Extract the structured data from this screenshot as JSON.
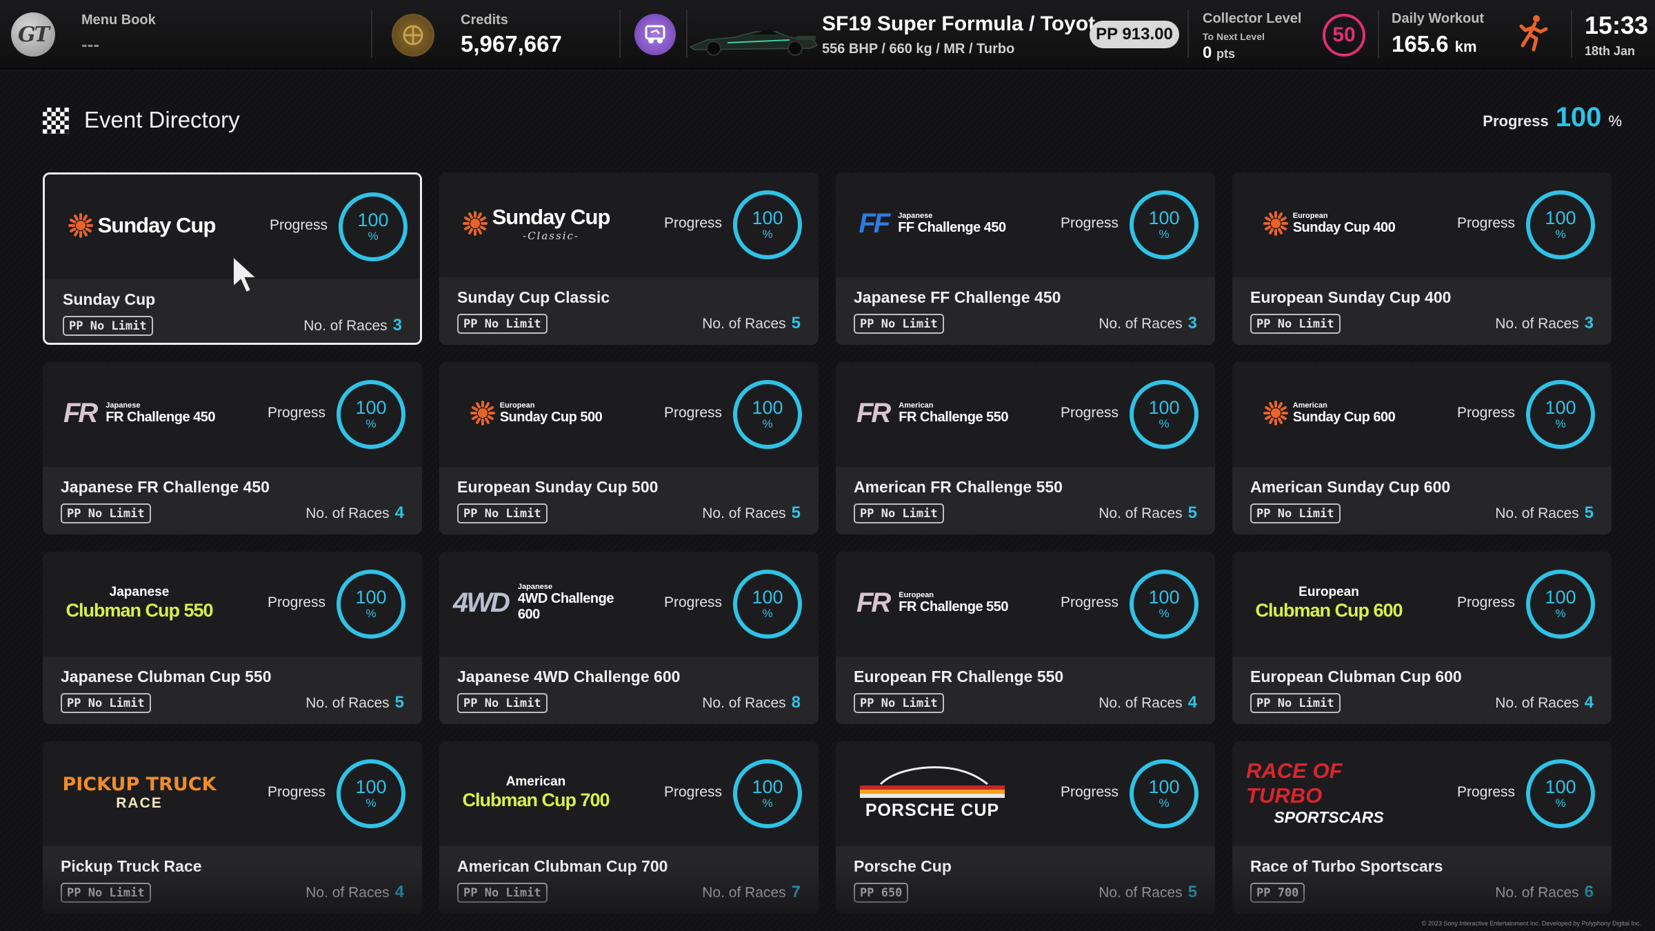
{
  "topbar": {
    "menu_book_label": "Menu Book",
    "menu_book_value": "---",
    "credits_label": "Credits",
    "credits_value": "5,967,667",
    "car_name": "SF19 Super Formula / Toyot...",
    "car_spec": "556 BHP / 660 kg / MR / Turbo",
    "car_pp": "PP 913.00",
    "collector_label": "Collector Level",
    "collector_sub": "To Next Level",
    "collector_points": "0",
    "collector_points_unit": "pts",
    "collector_level": "50",
    "workout_label": "Daily Workout",
    "workout_value": "165.6",
    "workout_unit": "km",
    "time": "15:33",
    "date": "18th Jan"
  },
  "header": {
    "title": "Event Directory",
    "progress_label": "Progress",
    "progress_value": "100",
    "progress_unit": "%"
  },
  "common": {
    "progress_label": "Progress",
    "percent": "%",
    "races_label": "No. of Races"
  },
  "events": [
    {
      "title": "Sunday Cup",
      "progress": "100",
      "pp": "PP No Limit",
      "races": "3",
      "logo": {
        "type": "sunday",
        "main": "Sunday Cup",
        "sub": ""
      }
    },
    {
      "title": "Sunday Cup Classic",
      "progress": "100",
      "pp": "PP No Limit",
      "races": "5",
      "logo": {
        "type": "sunday",
        "main": "Sunday Cup",
        "sub": "-Classic-"
      }
    },
    {
      "title": "Japanese FF Challenge 450",
      "progress": "100",
      "pp": "PP No Limit",
      "races": "3",
      "logo": {
        "type": "big",
        "big": "FF",
        "region": "Japanese",
        "main": "FF Challenge 450",
        "color": "#2b7de0"
      }
    },
    {
      "title": "European Sunday Cup 400",
      "progress": "100",
      "pp": "PP No Limit",
      "races": "3",
      "logo": {
        "type": "sunday-stack",
        "region": "European",
        "main": "Sunday Cup 400"
      }
    },
    {
      "title": "Japanese FR Challenge 450",
      "progress": "100",
      "pp": "PP No Limit",
      "races": "4",
      "logo": {
        "type": "big",
        "big": "FR",
        "region": "Japanese",
        "main": "FR Challenge 450",
        "color": "#d7c6cc"
      }
    },
    {
      "title": "European Sunday Cup 500",
      "progress": "100",
      "pp": "PP No Limit",
      "races": "5",
      "logo": {
        "type": "sunday-stack",
        "region": "European",
        "main": "Sunday Cup 500"
      }
    },
    {
      "title": "American FR Challenge 550",
      "progress": "100",
      "pp": "PP No Limit",
      "races": "5",
      "logo": {
        "type": "big",
        "big": "FR",
        "region": "American",
        "main": "FR Challenge 550",
        "color": "#d7c6cc"
      }
    },
    {
      "title": "American Sunday Cup 600",
      "progress": "100",
      "pp": "PP No Limit",
      "races": "5",
      "logo": {
        "type": "sunday-stack",
        "region": "American",
        "main": "Sunday Cup 600"
      }
    },
    {
      "title": "Japanese Clubman Cup 550",
      "progress": "100",
      "pp": "PP No Limit",
      "races": "5",
      "logo": {
        "type": "clubman",
        "region": "Japanese",
        "main": "Clubman Cup 550"
      }
    },
    {
      "title": "Japanese 4WD Challenge 600",
      "progress": "100",
      "pp": "PP No Limit",
      "races": "8",
      "logo": {
        "type": "big",
        "big": "4WD",
        "region": "Japanese",
        "main": "4WD Challenge 600",
        "color": "#b9bfd0"
      }
    },
    {
      "title": "European FR Challenge 550",
      "progress": "100",
      "pp": "PP No Limit",
      "races": "4",
      "logo": {
        "type": "big",
        "big": "FR",
        "region": "European",
        "main": "FR Challenge 550",
        "color": "#d7c6cc"
      }
    },
    {
      "title": "European Clubman Cup 600",
      "progress": "100",
      "pp": "PP No Limit",
      "races": "4",
      "logo": {
        "type": "clubman",
        "region": "European",
        "main": "Clubman Cup 600"
      }
    },
    {
      "title": "Pickup Truck Race",
      "progress": "100",
      "pp": "PP No Limit",
      "races": "4",
      "logo": {
        "type": "pickup",
        "l1": "PICKUP TRUCK",
        "l2": "RACE"
      }
    },
    {
      "title": "American Clubman Cup 700",
      "progress": "100",
      "pp": "PP No Limit",
      "races": "7",
      "logo": {
        "type": "clubman",
        "region": "American",
        "main": "Clubman Cup 700"
      }
    },
    {
      "title": "Porsche Cup",
      "progress": "100",
      "pp": "PP 650",
      "races": "5",
      "logo": {
        "type": "porsche",
        "main": "PORSCHE CUP"
      }
    },
    {
      "title": "Race of Turbo Sportscars",
      "progress": "100",
      "pp": "PP 700",
      "races": "6",
      "logo": {
        "type": "turbo",
        "l1": "RACE OF TURBO",
        "l2": "SPORTSCARS"
      }
    }
  ],
  "selected_index": 0,
  "copyright": "© 2023 Sony Interactive Entertainment Inc. Developed by Polyphony Digital Inc.",
  "colors": {
    "accent": "#2fc2e6",
    "level": "#e0306e",
    "clubman": "#d9f04a",
    "sunday_orange": "#e8632a"
  }
}
